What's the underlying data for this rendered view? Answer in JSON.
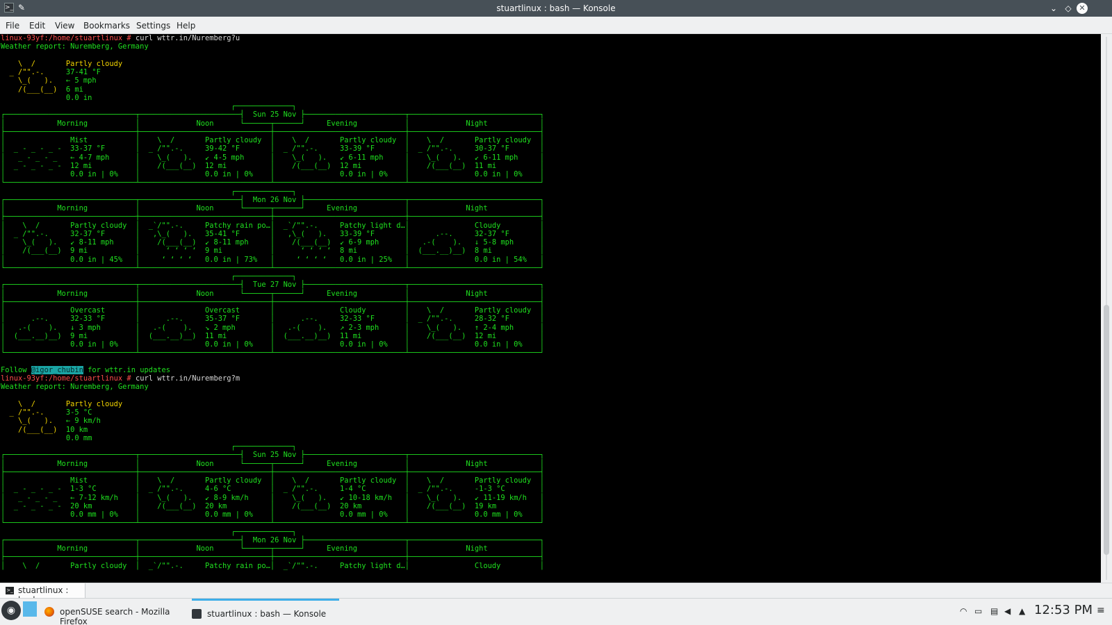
{
  "window": {
    "title": "stuartlinux : bash — Konsole",
    "app_icon": "terminal-icon",
    "pin_icon": "pin-icon"
  },
  "menu": {
    "items": [
      "File",
      "Edit",
      "View",
      "Bookmarks",
      "Settings",
      "Help"
    ]
  },
  "terminal": {
    "lines": [
      [
        {
          "t": "linux-93yf:/home/stuartlinux # ",
          "c": "prompt"
        },
        {
          "t": "curl wttr.in/Nuremberg?u",
          "c": "cmd"
        }
      ],
      [
        {
          "t": "Weather report: Nuremberg, Germany",
          "c": "grn"
        }
      ],
      [
        {
          "t": "",
          "c": "grn"
        }
      ],
      [
        {
          "t": "    \\  /       Partly cloudy",
          "c": "yel"
        }
      ],
      [
        {
          "t": "  _ /\"\".-.     ",
          "c": "yel"
        },
        {
          "t": "37-41 °F",
          "c": "grn"
        }
      ],
      [
        {
          "t": "    \\_(   ).   ",
          "c": "yel"
        },
        {
          "t": "← 5 mph",
          "c": "grn"
        }
      ],
      [
        {
          "t": "    /(___(__)  ",
          "c": "yel"
        },
        {
          "t": "6 mi",
          "c": "grn"
        }
      ],
      [
        {
          "t": "               0.0 in",
          "c": "grn"
        }
      ],
      [
        {
          "t": "                                                     ┌─────────────┐",
          "c": "grn"
        }
      ],
      [
        {
          "t": "┌──────────────────────────────┬───────────────────────┤  Sun 25 Nov ├───────────────────────┬──────────────────────────────┐",
          "c": "grn"
        }
      ],
      [
        {
          "t": "│            Morning           │             Noon      └──────┬──────┘     Evening           │             Night            │",
          "c": "grn"
        }
      ],
      [
        {
          "t": "├──────────────────────────────┼──────────────────────────────┼──────────────────────────────┼──────────────────────────────┤",
          "c": "grn"
        }
      ],
      [
        {
          "t": "│               Mist           │    \\  /       Partly cloudy  │    \\  /       Partly cloudy  │    \\  /       Partly cloudy  │",
          "c": "grn"
        }
      ],
      [
        {
          "t": "│  _ - _ - _ -  33-37 °F       │  _ /\"\".-.     39-42 °F       │  _ /\"\".-.     33-39 °F       │  _ /\"\".-.     30-37 °F       │",
          "c": "grn"
        }
      ],
      [
        {
          "t": "│   _ - _ - _   ← 4-7 mph      │    \\_(   ).   ↙ 4-5 mph      │    \\_(   ).   ↙ 6-11 mph     │    \\_(   ).   ↙ 6-11 mph     │",
          "c": "grn"
        }
      ],
      [
        {
          "t": "│  _ - _ - _ -  12 mi          │    /(___(__)  12 mi          │    /(___(__)  12 mi          │    /(___(__)  11 mi          │",
          "c": "grn"
        }
      ],
      [
        {
          "t": "│               0.0 in | 0%    │               0.0 in | 0%    │               0.0 in | 0%    │               0.0 in | 0%    │",
          "c": "grn"
        }
      ],
      [
        {
          "t": "└──────────────────────────────┴──────────────────────────────┴──────────────────────────────┴──────────────────────────────┘",
          "c": "grn"
        }
      ],
      [
        {
          "t": "                                                     ┌─────────────┐",
          "c": "grn"
        }
      ],
      [
        {
          "t": "┌──────────────────────────────┬───────────────────────┤  Mon 26 Nov ├───────────────────────┬──────────────────────────────┐",
          "c": "grn"
        }
      ],
      [
        {
          "t": "│            Morning           │             Noon      └──────┬──────┘     Evening           │             Night            │",
          "c": "grn"
        }
      ],
      [
        {
          "t": "├──────────────────────────────┼──────────────────────────────┼──────────────────────────────┼──────────────────────────────┤",
          "c": "grn"
        }
      ],
      [
        {
          "t": "│    \\  /       Partly cloudy  │  _`/\"\".-.     Patchy rain po…│  _`/\"\".-.     Patchy light d…│               Cloudy         │",
          "c": "grn"
        }
      ],
      [
        {
          "t": "│  _ /\"\".-.     32-37 °F       │   ,\\_(   ).   35-41 °F       │   ,\\_(   ).   33-39 °F       │      .--.     32-37 °F       │",
          "c": "grn"
        }
      ],
      [
        {
          "t": "│    \\_(   ).   ↙ 8-11 mph     │    /(___(__)  ↙ 8-11 mph     │    /(___(__)  ↙ 6-9 mph      │   .-(    ).   ↓ 5-8 mph      │",
          "c": "grn"
        }
      ],
      [
        {
          "t": "│    /(___(__)  9 mi           │      ‘ ‘ ‘ ‘  9 mi           │      ‘ ‘ ‘ ‘  8 mi           │  (___.__)__)  8 mi           │",
          "c": "grn"
        }
      ],
      [
        {
          "t": "│               0.0 in | 45%   │     ‘ ‘ ‘ ‘   0.0 in | 73%   │     ‘ ‘ ‘ ‘   0.0 in | 25%   │               0.0 in | 54%   │",
          "c": "grn"
        }
      ],
      [
        {
          "t": "└──────────────────────────────┴──────────────────────────────┴──────────────────────────────┴──────────────────────────────┘",
          "c": "grn"
        }
      ],
      [
        {
          "t": "                                                     ┌─────────────┐",
          "c": "grn"
        }
      ],
      [
        {
          "t": "┌──────────────────────────────┬───────────────────────┤  Tue 27 Nov ├───────────────────────┬──────────────────────────────┐",
          "c": "grn"
        }
      ],
      [
        {
          "t": "│            Morning           │             Noon      └──────┬──────┘     Evening           │             Night            │",
          "c": "grn"
        }
      ],
      [
        {
          "t": "├──────────────────────────────┼──────────────────────────────┼──────────────────────────────┼──────────────────────────────┤",
          "c": "grn"
        }
      ],
      [
        {
          "t": "│               Overcast       │               Overcast       │               Cloudy         │    \\  /       Partly cloudy  │",
          "c": "grn"
        }
      ],
      [
        {
          "t": "│      .--.     32-33 °F       │      .--.     35-37 °F       │      .--.     32-33 °F       │  _ /\"\".-.     28-32 °F       │",
          "c": "grn"
        }
      ],
      [
        {
          "t": "│   .-(    ).   ↓ 3 mph        │   .-(    ).   ↘ 2 mph        │   .-(    ).   ↗ 2-3 mph      │    \\_(   ).   ↑ 2-4 mph      │",
          "c": "grn"
        }
      ],
      [
        {
          "t": "│  (___.__)__)  9 mi           │  (___.__)__)  11 mi          │  (___.__)__)  11 mi          │    /(___(__)  12 mi          │",
          "c": "grn"
        }
      ],
      [
        {
          "t": "│               0.0 in | 0%    │               0.0 in | 0%    │               0.0 in | 0%    │               0.0 in | 0%    │",
          "c": "grn"
        }
      ],
      [
        {
          "t": "└──────────────────────────────┴──────────────────────────────┴──────────────────────────────┴──────────────────────────────┘",
          "c": "grn"
        }
      ],
      [
        {
          "t": "",
          "c": "grn"
        }
      ],
      [
        {
          "t": "Follow ",
          "c": "grn"
        },
        {
          "t": "@igor_chubin",
          "c": "hl"
        },
        {
          "t": " for wttr.in updates",
          "c": "grn"
        }
      ],
      [
        {
          "t": "linux-93yf:/home/stuartlinux # ",
          "c": "prompt"
        },
        {
          "t": "curl wttr.in/Nuremberg?m",
          "c": "cmd"
        }
      ],
      [
        {
          "t": "Weather report: Nuremberg, Germany",
          "c": "grn"
        }
      ],
      [
        {
          "t": "",
          "c": "grn"
        }
      ],
      [
        {
          "t": "    \\  /       Partly cloudy",
          "c": "yel"
        }
      ],
      [
        {
          "t": "  _ /\"\".-.     ",
          "c": "yel"
        },
        {
          "t": "3-5 °C",
          "c": "grn"
        }
      ],
      [
        {
          "t": "    \\_(   ).   ",
          "c": "yel"
        },
        {
          "t": "← 9 km/h",
          "c": "grn"
        }
      ],
      [
        {
          "t": "    /(___(__)  ",
          "c": "yel"
        },
        {
          "t": "10 km",
          "c": "grn"
        }
      ],
      [
        {
          "t": "               0.0 mm",
          "c": "grn"
        }
      ],
      [
        {
          "t": "                                                     ┌─────────────┐",
          "c": "grn"
        }
      ],
      [
        {
          "t": "┌──────────────────────────────┬───────────────────────┤  Sun 25 Nov ├───────────────────────┬──────────────────────────────┐",
          "c": "grn"
        }
      ],
      [
        {
          "t": "│            Morning           │             Noon      └──────┬──────┘     Evening           │             Night            │",
          "c": "grn"
        }
      ],
      [
        {
          "t": "├──────────────────────────────┼──────────────────────────────┼──────────────────────────────┼──────────────────────────────┤",
          "c": "grn"
        }
      ],
      [
        {
          "t": "│               Mist           │    \\  /       Partly cloudy  │    \\  /       Partly cloudy  │    \\  /       Partly cloudy  │",
          "c": "grn"
        }
      ],
      [
        {
          "t": "│  _ - _ - _ -  1-3 °C         │  _ /\"\".-.     4-6 °C         │  _ /\"\".-.     1-4 °C         │  _ /\"\".-.     -1-3 °C        │",
          "c": "grn"
        }
      ],
      [
        {
          "t": "│   _ - _ - _   ← 7-12 km/h    │    \\_(   ).   ↙ 8-9 km/h     │    \\_(   ).   ↙ 10-18 km/h   │    \\_(   ).   ↙ 11-19 km/h   │",
          "c": "grn"
        }
      ],
      [
        {
          "t": "│  _ - _ - _ -  20 km          │    /(___(__)  20 km          │    /(___(__)  20 km          │    /(___(__)  19 km          │",
          "c": "grn"
        }
      ],
      [
        {
          "t": "│               0.0 mm | 0%    │               0.0 mm | 0%    │               0.0 mm | 0%    │               0.0 mm | 0%    │",
          "c": "grn"
        }
      ],
      [
        {
          "t": "└──────────────────────────────┴──────────────────────────────┴──────────────────────────────┴──────────────────────────────┘",
          "c": "grn"
        }
      ],
      [
        {
          "t": "                                                     ┌─────────────┐",
          "c": "grn"
        }
      ],
      [
        {
          "t": "┌──────────────────────────────┬───────────────────────┤  Mon 26 Nov ├───────────────────────┬──────────────────────────────┐",
          "c": "grn"
        }
      ],
      [
        {
          "t": "│            Morning           │             Noon      └──────┬──────┘     Evening           │             Night            │",
          "c": "grn"
        }
      ],
      [
        {
          "t": "├──────────────────────────────┼──────────────────────────────┼──────────────────────────────┼──────────────────────────────┤",
          "c": "grn"
        }
      ],
      [
        {
          "t": "│    \\  /       Partly cloudy  │  _`/\"\".-.     Patchy rain po…│  _`/\"\".-.     Patchy light d…│               Cloudy         │",
          "c": "grn"
        }
      ]
    ]
  },
  "session_tab": {
    "label": "stuartlinux : bash",
    "icon": "terminal-icon"
  },
  "taskbar": {
    "launcher_icon": "opensuse-icon",
    "desktop_icon": "show-desktop-icon",
    "tasks": [
      {
        "label": "openSUSE search - Mozilla Firefox",
        "icon": "firefox-icon"
      },
      {
        "label": "stuartlinux : bash — Konsole",
        "icon": "konsole-icon"
      }
    ],
    "tray_icons": [
      "wifi-icon",
      "battery-icon",
      "clipboard-icon",
      "volume-icon",
      "tray-expand-icon"
    ],
    "clock": "12:53 PM"
  },
  "colors": {
    "terminal_bg": "#000000",
    "terminal_green": "#1fe11f",
    "prompt_red": "#ff4d4d",
    "highlight": "#1aa5a5",
    "accent": "#3daee9"
  }
}
